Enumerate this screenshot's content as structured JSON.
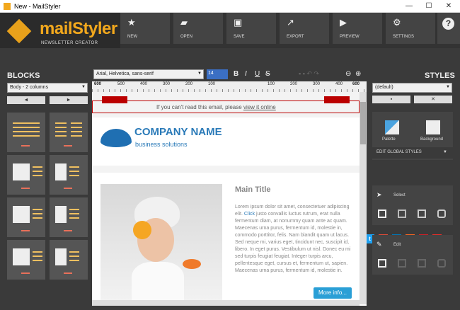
{
  "window": {
    "title": "New - MailStyler",
    "minimize": "—",
    "maximize": "☐",
    "close": "✕"
  },
  "logo": {
    "name": "mailStyler",
    "sub": "NEWSLETTER CREATOR"
  },
  "toolbar": [
    {
      "label": "NEW",
      "icon": "★"
    },
    {
      "label": "OPEN",
      "icon": "▰"
    },
    {
      "label": "SAVE",
      "icon": "▣"
    },
    {
      "label": "EXPORT",
      "icon": "↗"
    },
    {
      "label": "PREVIEW",
      "icon": "▶"
    },
    {
      "label": "SETTINGS",
      "icon": "⚙"
    }
  ],
  "help": {
    "label": "?"
  },
  "blocks": {
    "title": "BLOCKS",
    "layout": "Body - 2 columns",
    "prev": "◄",
    "next": "►"
  },
  "format": {
    "font": "Arial, Helvetica, sans-serif",
    "size": "14",
    "bold": "B",
    "italic": "I",
    "underline": "U",
    "strike": "S"
  },
  "ruler": {
    "left_start": "600",
    "left_marks": [
      "500",
      "400",
      "300",
      "200",
      "100"
    ],
    "right_marks": [
      "100",
      "200",
      "300",
      "400",
      "500"
    ],
    "right_end": "600",
    "center": "0"
  },
  "email": {
    "preheader": "If you can't read this email, please ",
    "preheader_link": "view it online",
    "company": "COMPANY NAME",
    "tagline": "business solutions",
    "main_title": "Main Title",
    "body_before_link": "Lorem ipsum dolor sit amet, consectetuer adipiscing elit. ",
    "body_link": "Click",
    "body_after_link": " justo convallis luctus rutrum, erat nulla fermentum diam, at nonummy quam ante ac quam. Maecenas urna purus, fermentum id, molestie in, commodo porttitor, felis. Nam blandit quam ut lacus. Sed neque mi, varius eget, tincidunt nec, suscipit id, libero. In eget purus. Vestibulum ut nisl. Donec eu mi sed turpis feugiat feugiat. Integer turpis arcu, pellentesque eget, cursus et, fermentum ut, sapien. Maecenas urna purus, fermentum id, molestie in.",
    "more_button": "More info..."
  },
  "styles": {
    "title": "STYLES",
    "preset": "(default)",
    "palette": "Palette",
    "background": "Background",
    "edit_global": "EDIT GLOBAL STYLES",
    "select": "Select",
    "edit": "Edit"
  },
  "social": [
    {
      "icon": "f",
      "color": "#3b5998"
    },
    {
      "icon": "t",
      "color": "#1da1f2"
    },
    {
      "icon": "g+",
      "color": "#dd4b39"
    },
    {
      "icon": "in",
      "color": "#0077b5"
    },
    {
      "icon": "rss",
      "color": "#f26522"
    },
    {
      "icon": "p",
      "color": "#cb2027"
    },
    {
      "icon": "▶",
      "color": "#e52d27"
    }
  ]
}
